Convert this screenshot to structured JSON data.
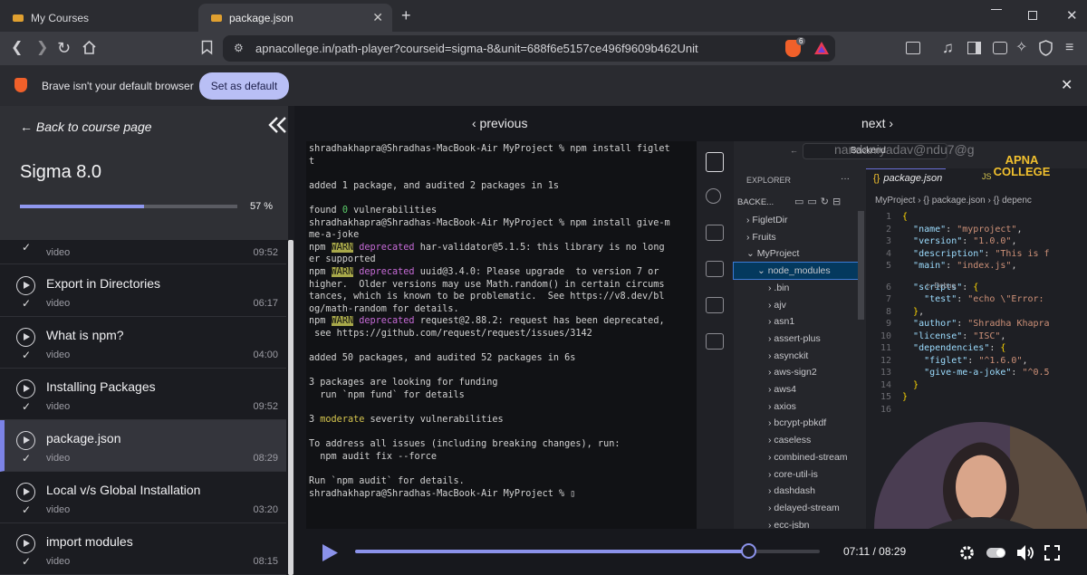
{
  "browser": {
    "tabs": [
      {
        "label": "My Courses"
      },
      {
        "label": "package.json"
      }
    ],
    "new_tab": "+",
    "url": "apnacollege.in/path-player?courseid=sigma-8&unit=688f6e5157ce496f9609b462Unit",
    "shield_count": "6"
  },
  "banner": {
    "message": "Brave isn't your default browser",
    "button": "Set as default"
  },
  "sidebar": {
    "back_label": "← Back to course page",
    "course_title": "Sigma 8.0",
    "progress_text": "57 %",
    "progress_fraction": 0.57,
    "partial_item": {
      "type": "video",
      "duration": "09:52"
    },
    "lessons": [
      {
        "title": "Export in Directories",
        "type": "video",
        "duration": "06:17"
      },
      {
        "title": "What is npm?",
        "type": "video",
        "duration": "04:00"
      },
      {
        "title": "Installing Packages",
        "type": "video",
        "duration": "09:52"
      },
      {
        "title": "package.json",
        "type": "video",
        "duration": "08:29"
      },
      {
        "title": "Local v/s Global Installation",
        "type": "video",
        "duration": "03:20"
      },
      {
        "title": "import modules",
        "type": "video",
        "duration": "08:15"
      }
    ],
    "active_index": 3
  },
  "player": {
    "previous": "‹ previous",
    "next": "next ›",
    "current_time": "07:11",
    "total_time": "08:29",
    "timecode": "07:11 / 08:29",
    "played_fraction": 0.847
  },
  "terminal": {
    "lines": [
      [
        "shradhakhapra@Shradhas-MacBook-Air MyProject % npm install figlet"
      ],
      [
        "t"
      ],
      [
        ""
      ],
      [
        "added 1 package, and audited 2 packages in 1s"
      ],
      [
        ""
      ],
      [
        "found ",
        {
          "c": "grn",
          "t": "0"
        },
        " vulnerabilities"
      ],
      [
        "shradhakhapra@Shradhas-MacBook-Air MyProject % npm install give-m"
      ],
      [
        "me-a-joke"
      ],
      [
        "npm ",
        {
          "c": "warn",
          "t": "WARN"
        },
        " ",
        {
          "c": "dep",
          "t": "deprecated"
        },
        " har-validator@5.1.5: this library is no long"
      ],
      [
        "er supported"
      ],
      [
        "npm ",
        {
          "c": "warn",
          "t": "WARN"
        },
        " ",
        {
          "c": "dep",
          "t": "deprecated"
        },
        " uuid@3.4.0: Please upgrade  to version 7 or"
      ],
      [
        "higher.  Older versions may use Math.random() in certain circums"
      ],
      [
        "tances, which is known to be problematic.  See https://v8.dev/bl"
      ],
      [
        "og/math-random for details."
      ],
      [
        "npm ",
        {
          "c": "warn",
          "t": "WARN"
        },
        " ",
        {
          "c": "dep",
          "t": "deprecated"
        },
        " request@2.88.2: request has been deprecated,"
      ],
      [
        " see https://github.com/request/request/issues/3142"
      ],
      [
        ""
      ],
      [
        "added 50 packages, and audited 52 packages in 6s"
      ],
      [
        ""
      ],
      [
        "3 packages are looking for funding"
      ],
      [
        "  run `npm fund` for details"
      ],
      [
        ""
      ],
      [
        "3 ",
        {
          "c": "yel",
          "t": "moderate"
        },
        " severity vulnerabilities"
      ],
      [
        ""
      ],
      [
        "To address all issues (including breaking changes), run:"
      ],
      [
        "  npm audit fix --force"
      ],
      [
        ""
      ],
      [
        "Run `npm audit` for details."
      ],
      [
        "shradhakhapra@Shradhas-MacBook-Air MyProject % ▯"
      ]
    ]
  },
  "vscode": {
    "watermark_user": "nandaniyadav@ndu7@g",
    "search_label": "Backend",
    "brand": "APNA COLLEGE",
    "explorer_title": "EXPLORER",
    "explorer_dots": "···",
    "section": "BACKE...",
    "tree": [
      {
        "label": "FigletDir",
        "indent": 1,
        "arrow": "›"
      },
      {
        "label": "Fruits",
        "indent": 1,
        "arrow": "›"
      },
      {
        "label": "MyProject",
        "indent": 1,
        "arrow": "⌄"
      },
      {
        "label": "node_modules",
        "indent": 2,
        "arrow": "⌄",
        "selected": true
      },
      {
        "label": ".bin",
        "indent": 3,
        "arrow": "›"
      },
      {
        "label": "ajv",
        "indent": 3,
        "arrow": "›"
      },
      {
        "label": "asn1",
        "indent": 3,
        "arrow": "›"
      },
      {
        "label": "assert-plus",
        "indent": 3,
        "arrow": "›"
      },
      {
        "label": "asynckit",
        "indent": 3,
        "arrow": "›"
      },
      {
        "label": "aws-sign2",
        "indent": 3,
        "arrow": "›"
      },
      {
        "label": "aws4",
        "indent": 3,
        "arrow": "›"
      },
      {
        "label": "axios",
        "indent": 3,
        "arrow": "›"
      },
      {
        "label": "bcrypt-pbkdf",
        "indent": 3,
        "arrow": "›"
      },
      {
        "label": "caseless",
        "indent": 3,
        "arrow": "›"
      },
      {
        "label": "combined-stream",
        "indent": 3,
        "arrow": "›"
      },
      {
        "label": "core-util-is",
        "indent": 3,
        "arrow": "›"
      },
      {
        "label": "dashdash",
        "indent": 3,
        "arrow": "›"
      },
      {
        "label": "delayed-stream",
        "indent": 3,
        "arrow": "›"
      },
      {
        "label": "ecc-jsbn",
        "indent": 3,
        "arrow": "›"
      }
    ],
    "editor_tab": "package.json",
    "editor_tab_icon": "{}",
    "second_tab_icon": "JS",
    "breadcrumb": "MyProject › {} package.json › {} depenc",
    "debug_label": "▷ Debug",
    "code": [
      {
        "n": "1",
        "t": [
          {
            "c": "brc",
            "t": "{"
          }
        ]
      },
      {
        "n": "2",
        "t": [
          "  ",
          {
            "c": "key",
            "t": "\"name\""
          },
          ": ",
          {
            "c": "str",
            "t": "\"myproject\""
          },
          ","
        ]
      },
      {
        "n": "3",
        "t": [
          "  ",
          {
            "c": "key",
            "t": "\"version\""
          },
          ": ",
          {
            "c": "str",
            "t": "\"1.0.0\""
          },
          ","
        ]
      },
      {
        "n": "4",
        "t": [
          "  ",
          {
            "c": "key",
            "t": "\"description\""
          },
          ": ",
          {
            "c": "str",
            "t": "\"This is f"
          }
        ]
      },
      {
        "n": "5",
        "t": [
          "  ",
          {
            "c": "key",
            "t": "\"main\""
          },
          ": ",
          {
            "c": "str",
            "t": "\"index.js\""
          },
          ","
        ]
      },
      {
        "n": "6",
        "t": [
          "  ",
          {
            "c": "key",
            "t": "\"scripts\""
          },
          ": ",
          {
            "c": "brc",
            "t": "{"
          }
        ]
      },
      {
        "n": "7",
        "t": [
          "    ",
          {
            "c": "key",
            "t": "\"test\""
          },
          ": ",
          {
            "c": "str",
            "t": "\"echo \\\"Error:"
          }
        ]
      },
      {
        "n": "8",
        "t": [
          "  ",
          {
            "c": "brc",
            "t": "}"
          },
          ","
        ]
      },
      {
        "n": "9",
        "t": [
          "  ",
          {
            "c": "key",
            "t": "\"author\""
          },
          ": ",
          {
            "c": "str",
            "t": "\"Shradha Khapra"
          }
        ]
      },
      {
        "n": "10",
        "t": [
          "  ",
          {
            "c": "key",
            "t": "\"license\""
          },
          ": ",
          {
            "c": "str",
            "t": "\"ISC\""
          },
          ","
        ]
      },
      {
        "n": "11",
        "t": [
          "  ",
          {
            "c": "key",
            "t": "\"dependencies\""
          },
          ": ",
          {
            "c": "brc",
            "t": "{"
          }
        ]
      },
      {
        "n": "12",
        "t": [
          "    ",
          {
            "c": "key",
            "t": "\"figlet\""
          },
          ": ",
          {
            "c": "str",
            "t": "\"^1.6.0\""
          },
          ","
        ]
      },
      {
        "n": "13",
        "t": [
          "    ",
          {
            "c": "key",
            "t": "\"give-me-a-joke\""
          },
          ": ",
          {
            "c": "str",
            "t": "\"^0.5"
          }
        ]
      },
      {
        "n": "14",
        "t": [
          "  ",
          {
            "c": "brc",
            "t": "}"
          }
        ]
      },
      {
        "n": "15",
        "t": [
          {
            "c": "brc",
            "t": "}"
          }
        ]
      },
      {
        "n": "16",
        "t": [
          ""
        ]
      }
    ]
  },
  "colors": {
    "accent": "#8b92ea",
    "banner_button": "#b9bff5",
    "sidebar_bg": "#1b1c21",
    "header_bg": "#2f3035"
  },
  "icons": {
    "back": "chevron-left-icon",
    "forward": "chevron-right-icon",
    "reload": "reload-icon",
    "home": "home-icon",
    "bookmark": "bookmark-icon",
    "collapse": "double-chevron-left-icon",
    "play": "play-icon",
    "settings": "gear-icon",
    "volume": "speaker-icon",
    "fullscreen": "fullscreen-icon"
  }
}
